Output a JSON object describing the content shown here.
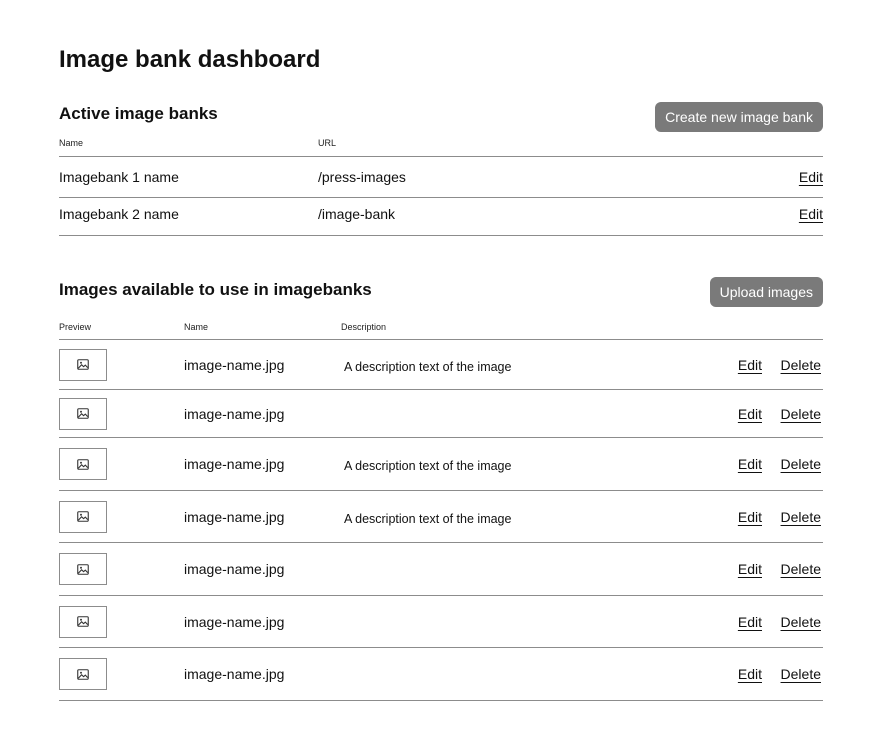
{
  "page": {
    "title": "Image bank dashboard"
  },
  "active_banks": {
    "title": "Active image banks",
    "create_button_label": "Create new image bank",
    "columns": {
      "name": "Name",
      "url": "URL"
    },
    "rows": [
      {
        "name": "Imagebank 1 name",
        "url": "/press-images",
        "edit_label": "Edit"
      },
      {
        "name": "Imagebank 2 name",
        "url": "/image-bank",
        "edit_label": "Edit"
      }
    ]
  },
  "images": {
    "title": "Images available to use in imagebanks",
    "upload_button_label": "Upload images",
    "columns": {
      "preview": "Preview",
      "name": "Name",
      "description": "Description"
    },
    "preview_icon": "image-icon",
    "rows": [
      {
        "name": "image-name.jpg",
        "description": "A description text of the image",
        "edit_label": "Edit",
        "delete_label": "Delete"
      },
      {
        "name": "image-name.jpg",
        "description": "",
        "edit_label": "Edit",
        "delete_label": "Delete"
      },
      {
        "name": "image-name.jpg",
        "description": "A description text of the image",
        "edit_label": "Edit",
        "delete_label": "Delete"
      },
      {
        "name": "image-name.jpg",
        "description": "A description text of the image",
        "edit_label": "Edit",
        "delete_label": "Delete"
      },
      {
        "name": "image-name.jpg",
        "description": "",
        "edit_label": "Edit",
        "delete_label": "Delete"
      },
      {
        "name": "image-name.jpg",
        "description": "",
        "edit_label": "Edit",
        "delete_label": "Delete"
      },
      {
        "name": "image-name.jpg",
        "description": "",
        "edit_label": "Edit",
        "delete_label": "Delete"
      }
    ]
  }
}
